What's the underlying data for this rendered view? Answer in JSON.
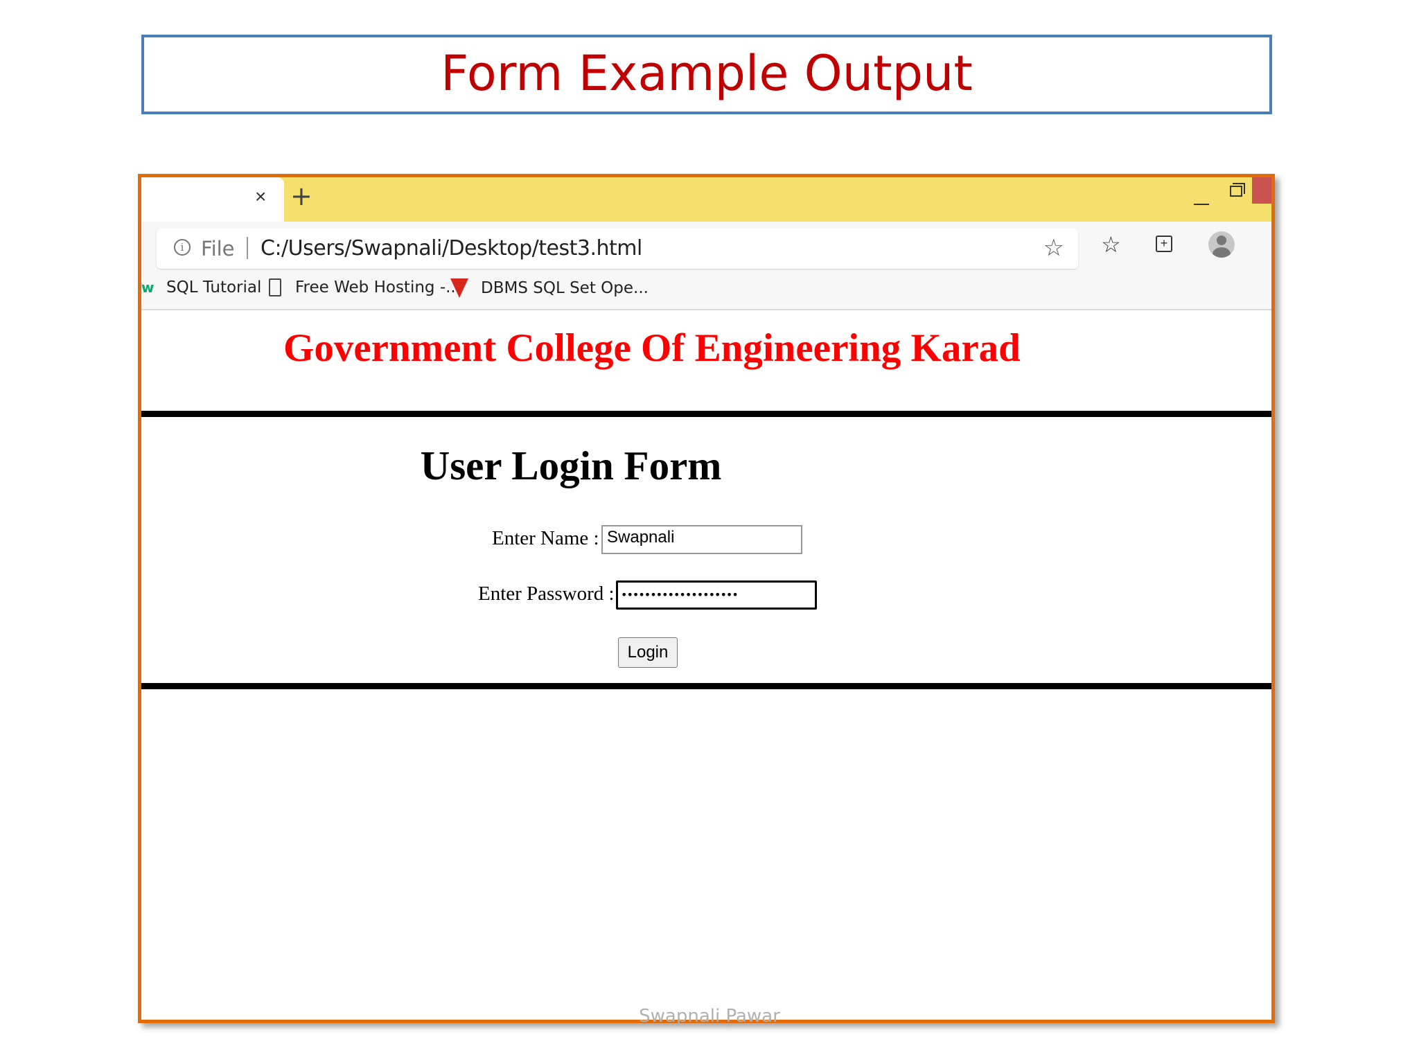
{
  "slide": {
    "title": "Form Example Output",
    "footer": "Swapnali Pawar"
  },
  "browser": {
    "tab": {
      "close_glyph": "×",
      "new_tab_glyph": "+"
    },
    "address_bar": {
      "scheme_label": "File",
      "url": "C:/Users/Swapnali/Desktop/test3.html"
    },
    "bookmarks": [
      {
        "label": "SQL Tutorial",
        "icon": "w3schools-icon"
      },
      {
        "label": "Free Web Hosting -...",
        "icon": "page-icon"
      },
      {
        "label": "DBMS SQL Set Ope...",
        "icon": "triangle-logo-icon"
      }
    ]
  },
  "page": {
    "college_title": "Government College Of Engineering Karad",
    "form_heading": "User Login Form",
    "name_label": "Enter Name :",
    "name_value": "Swapnali",
    "password_label": "Enter Password :",
    "password_value": "••••••••••••••••••••",
    "login_label": "Login"
  },
  "colors": {
    "slide_title": "#c00000",
    "slide_box_border": "#4a7ebb",
    "frame_border": "#e36c09",
    "tab_strip": "#f5e06e",
    "college_title": "#ff0000"
  }
}
